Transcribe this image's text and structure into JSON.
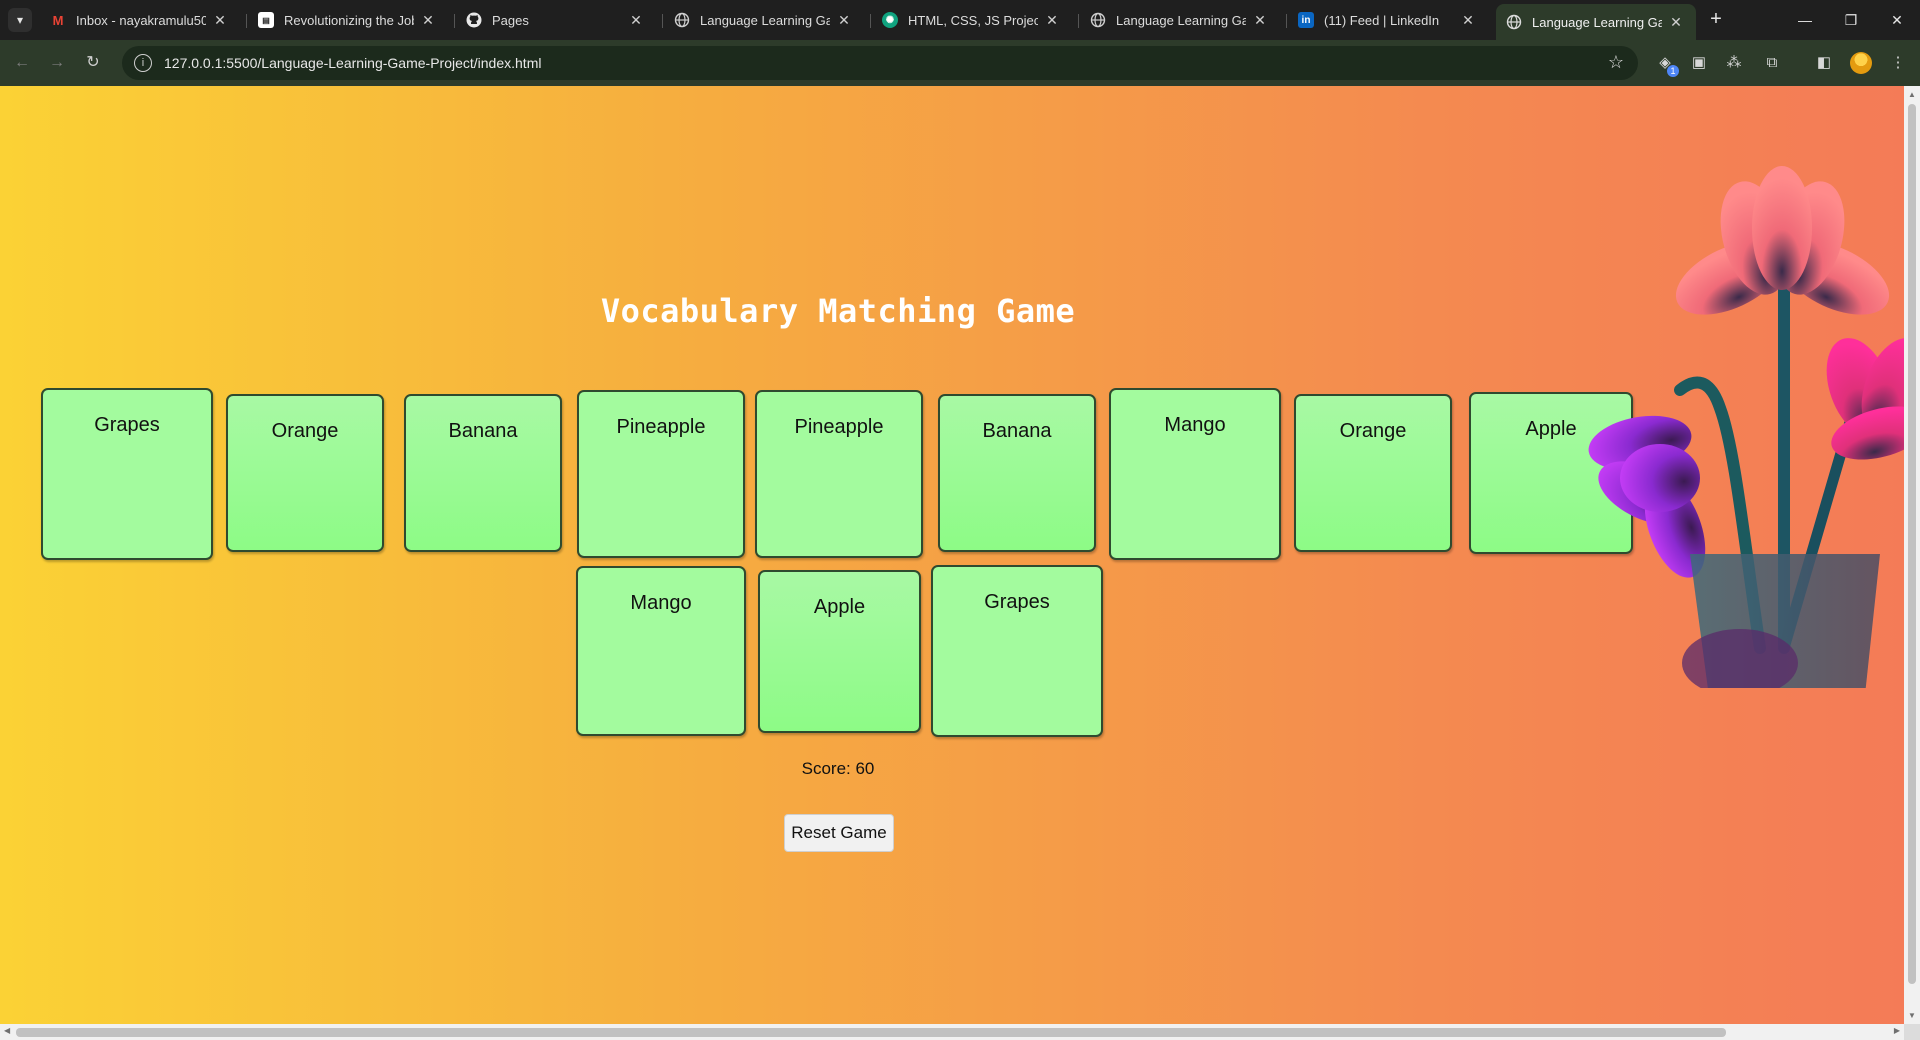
{
  "browser": {
    "tabs": [
      {
        "title": "Inbox - nayakramulu50@",
        "icon": "gmail-icon",
        "active": false
      },
      {
        "title": "Revolutionizing the Job M",
        "icon": "article-icon",
        "active": false
      },
      {
        "title": "Pages",
        "icon": "github-icon",
        "active": false
      },
      {
        "title": "Language Learning Game",
        "icon": "globe-icon",
        "active": false
      },
      {
        "title": "HTML, CSS, JS Projects",
        "icon": "chatgpt-icon",
        "active": false
      },
      {
        "title": "Language Learning Game",
        "icon": "globe-icon",
        "active": false
      },
      {
        "title": "(11) Feed | LinkedIn",
        "icon": "linkedin-icon",
        "active": false
      },
      {
        "title": "Language Learning Game",
        "icon": "globe-icon",
        "active": true
      }
    ],
    "url": "127.0.0.1:5500/Language-Learning-Game-Project/index.html"
  },
  "game": {
    "title": "Vocabulary Matching Game",
    "cards_row1": [
      "Grapes",
      "Orange",
      "Banana",
      "Pineapple",
      "Pineapple",
      "Banana",
      "Mango",
      "Orange",
      "Apple"
    ],
    "cards_row2": [
      "Mango",
      "Apple",
      "Grapes"
    ],
    "score": "Score: 60",
    "reset_label": "Reset Game"
  },
  "colors": {
    "card_green": "#a3fb9e",
    "bg_gradient_start": "#fbd235",
    "bg_gradient_end": "#f47b57",
    "chrome_toolbar": "#2d3b2a"
  }
}
